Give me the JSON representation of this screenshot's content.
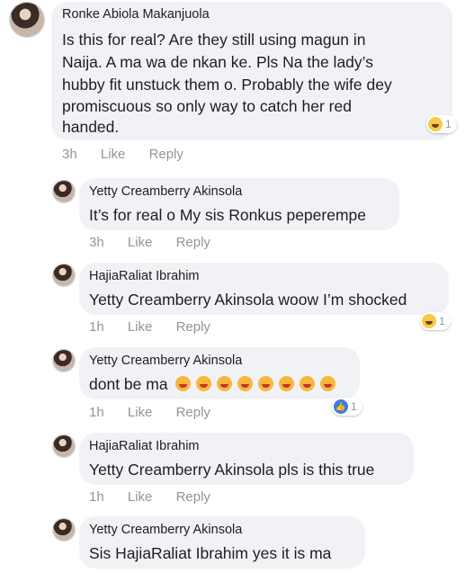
{
  "comments": [
    {
      "author": "Ronke Abiola Makanjuola",
      "lines": [
        "Is this for real? Are they still using magun in",
        "Naija. A ma wa de nkan ke. Pls Na the lady’s",
        "hubby fit unstuck them o. Probably the wife dey",
        "promiscuous so only way to catch her red",
        "handed."
      ],
      "time": "3h",
      "like": "Like",
      "reply": "Reply",
      "reaction": {
        "icon": "haha-reaction-icon",
        "count": "1"
      }
    },
    {
      "author": "Yetty Creamberry Akinsola",
      "lines": [
        "It’s for real o My sis Ronkus peperempe"
      ],
      "time": "3h",
      "like": "Like",
      "reply": "Reply"
    },
    {
      "author": "HajiaRaliat Ibrahim",
      "lines": [
        "Yetty Creamberry Akinsola  woow I’m shocked"
      ],
      "time": "1h",
      "like": "Like",
      "reply": "Reply",
      "reaction": {
        "icon": "haha-reaction-icon",
        "count": "1"
      }
    },
    {
      "author": "Yetty Creamberry Akinsola",
      "lines": [
        "dont be ma"
      ],
      "emoji_count": 8,
      "emoji_icon": "heart-eyes-emoji-icon",
      "time": "1h",
      "like": "Like",
      "reply": "Reply",
      "reaction": {
        "icon": "like-reaction-icon",
        "count": "1"
      }
    },
    {
      "author": "HajiaRaliat Ibrahim",
      "lines": [
        "Yetty Creamberry Akinsola  pls is this true"
      ],
      "time": "1h",
      "like": "Like",
      "reply": "Reply"
    },
    {
      "author": "Yetty Creamberry Akinsola",
      "lines": [
        "Sis HajiaRaliat Ibrahim  yes it is ma"
      ]
    }
  ],
  "colors": {
    "bubble": "#f1f2f6",
    "meta_text": "#90949c",
    "like_blue": "#3b7de7",
    "haha_yellow": "#f7c948"
  }
}
